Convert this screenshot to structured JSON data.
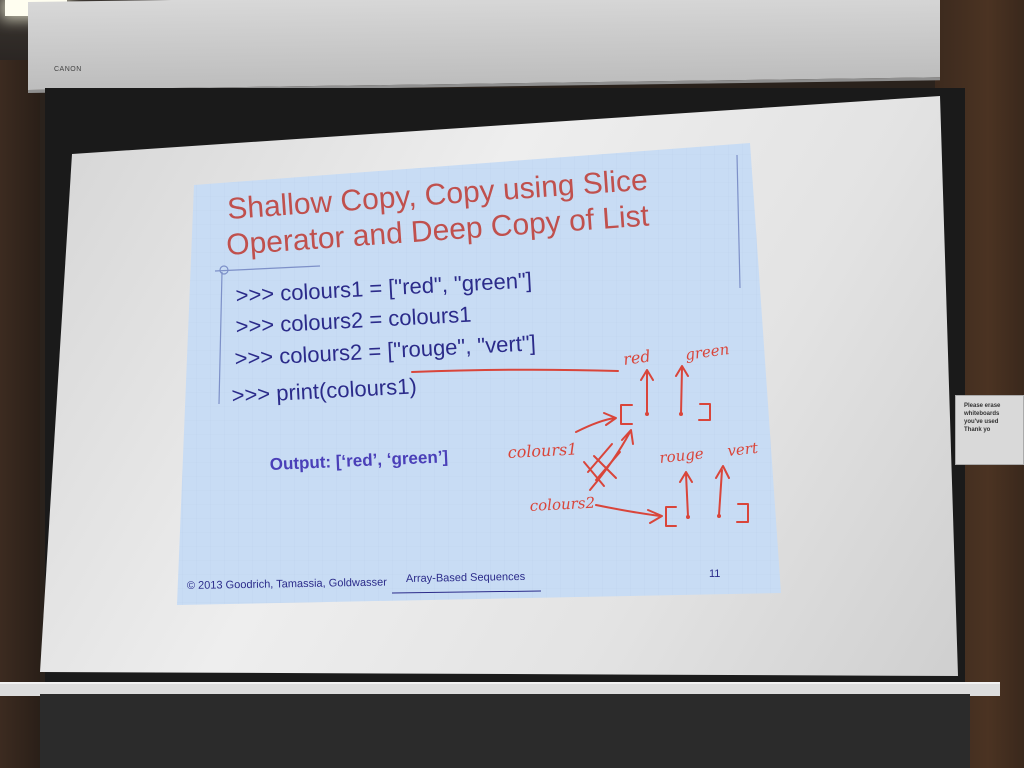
{
  "room": {
    "projector_label": "CANON",
    "notice_lines": [
      "Please erase",
      "whiteboards",
      "you've used",
      "Thank yo"
    ]
  },
  "slide": {
    "title_line1": "Shallow Copy, Copy using Slice",
    "title_line2": "Operator and Deep Copy of List",
    "code_lines": [
      ">>> colours1 = [\"red\", \"green\"]",
      ">>> colours2 = colours1",
      ">>> colours2 = [\"rouge\", \"vert\"]",
      ">>> print(colours1)"
    ],
    "output": "Output: [‘red’, ‘green’]",
    "footer_copyright": "© 2013 Goodrich, Tamassia, Goldwasser",
    "footer_title": "Array-Based Sequences",
    "page_number": "11",
    "colors": {
      "background": "#c8dcf4",
      "title": "#c0504d",
      "code": "#2b2b8a",
      "output": "#4a3fb8",
      "ink": "#d9453a"
    }
  },
  "annotations": {
    "red": "red",
    "green": "green",
    "colours1": "colours1",
    "colours2": "colours2",
    "rouge": "rouge",
    "vert": "vert"
  }
}
